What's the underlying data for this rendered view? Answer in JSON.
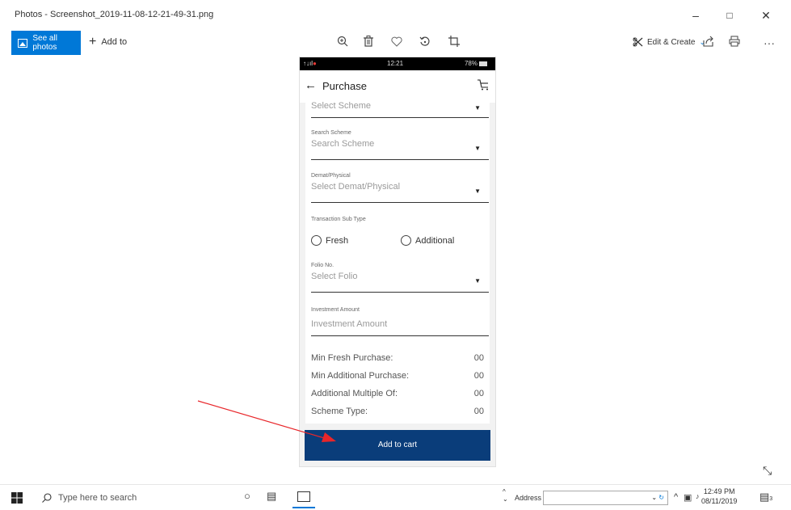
{
  "window": {
    "title": "Photos - Screenshot_2019-11-08-12-21-49-31.png",
    "controls": [
      "–",
      "□",
      "✕"
    ]
  },
  "toolbar": {
    "see_all_label": "See all photos",
    "add_to_label": "Add to",
    "icons": [
      "zoom-icon",
      "delete-icon",
      "favorite-icon",
      "rotate-icon",
      "crop-icon"
    ],
    "edit_create_label": "Edit & Create",
    "right_icons": [
      "share-icon",
      "print-icon",
      "more-icon"
    ]
  },
  "phone": {
    "status": {
      "signal": "↑↓ıl↑ıl",
      "time": "12:21",
      "battery": "78%"
    },
    "appbar_title": "Purchase",
    "fields": [
      {
        "label": "",
        "value": "Select Scheme",
        "dropdown": true
      },
      {
        "label": "Search Scheme",
        "value": "Search Scheme",
        "dropdown": true
      },
      {
        "label": "Demat/Physical",
        "value": "Select Demat/Physical",
        "dropdown": true
      },
      {
        "label": "Transaction Sub Type",
        "value": "",
        "dropdown": false
      },
      {
        "label": "Folio No.",
        "value": "Select Folio",
        "dropdown": true
      },
      {
        "label": "Investment Amount",
        "value": "Investment Amount",
        "dropdown": false
      }
    ],
    "radios": [
      "Fresh",
      "Additional"
    ],
    "summary": [
      {
        "label": "Min Fresh Purchase:",
        "value": "00"
      },
      {
        "label": "Min Additional Purchase:",
        "value": "00"
      },
      {
        "label": "Additional Multiple Of:",
        "value": "00"
      },
      {
        "label": "Scheme Type:",
        "value": "00"
      }
    ],
    "add_to_cart_label": "Add to cart"
  },
  "annotation": {
    "color": "#e8262a"
  },
  "taskbar": {
    "search_placeholder": "Type here to search",
    "address_label": "Address",
    "time": "12:49 PM",
    "date": "08/11/2019",
    "notification_count": "3"
  },
  "colors": {
    "accent": "#0078d7",
    "button": "#0a3d7a"
  }
}
